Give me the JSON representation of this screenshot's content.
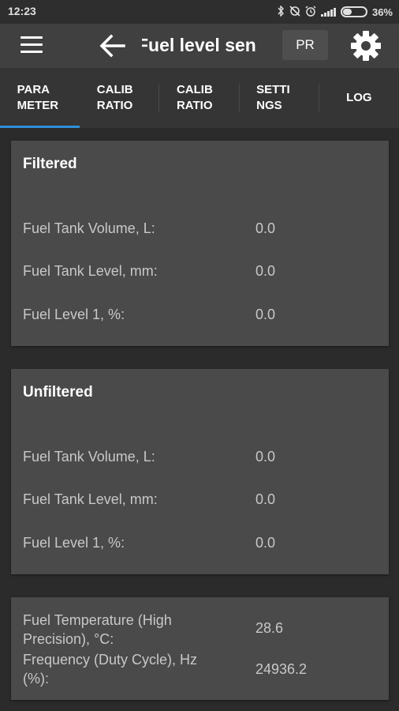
{
  "status_bar": {
    "time": "12:23",
    "icons": [
      "bluetooth-icon",
      "sync-off-icon",
      "alarm-icon",
      "signal-icon",
      "battery-icon"
    ],
    "battery": "36%",
    "battery_level": 0.36
  },
  "toolbar": {
    "title": "Fuel level sen",
    "pr_label": "PR",
    "icons": [
      "menu-icon",
      "back-arrow-icon",
      "gear-icon"
    ]
  },
  "tabs": [
    {
      "label": "PARA\nMETER",
      "active": true
    },
    {
      "label": "CALIB\nRATIO",
      "active": false
    },
    {
      "label": "CALIB\nRATIO",
      "active": false
    },
    {
      "label": "SETTI\nNGS",
      "active": false
    },
    {
      "label": "LOG",
      "active": false
    }
  ],
  "filtered": {
    "title": "Filtered",
    "rows": [
      {
        "label": "Fuel Tank Volume, L:",
        "value": "0.0"
      },
      {
        "label": "Fuel Tank Level, mm:",
        "value": "0.0"
      },
      {
        "label": "Fuel Level 1, %:",
        "value": "0.0"
      }
    ]
  },
  "unfiltered": {
    "title": "Unfiltered",
    "rows": [
      {
        "label": "Fuel Tank Volume, L:",
        "value": "0.0"
      },
      {
        "label": "Fuel Tank Level, mm:",
        "value": "0.0"
      },
      {
        "label": "Fuel Level 1, %:",
        "value": "0.0"
      }
    ]
  },
  "extra": {
    "rows": [
      {
        "label": "Fuel Temperature (High Precision), °C:",
        "value": "28.6"
      },
      {
        "label": "Frequency (Duty Cycle), Hz (%):",
        "value": "24936.2"
      }
    ]
  },
  "colors": {
    "background": "#2b2b2b",
    "toolbar": "#404040",
    "tabs": "#353535",
    "card": "#4a4a4a",
    "accent": "#2f8fd8",
    "label_text": "#c8c8c8"
  }
}
